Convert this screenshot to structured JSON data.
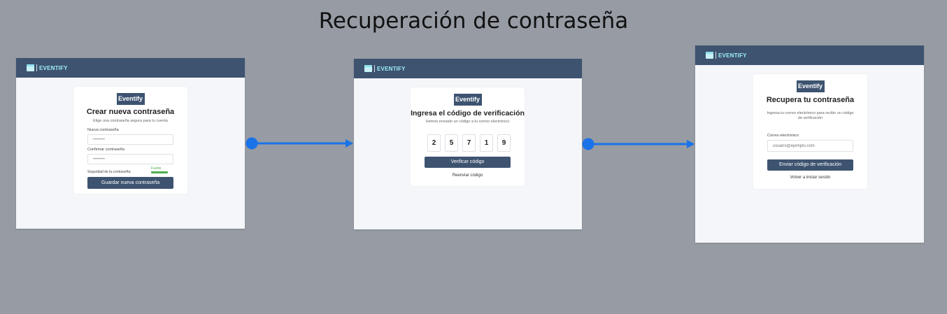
{
  "page_title": "Recuperación de contraseña",
  "colors": {
    "background": "#969ba4",
    "header": "#3d5370",
    "accent_arrow": "#1a73e8",
    "logo_text": "#9ef0f4",
    "strength_bar": "#4caf50"
  },
  "app_logo": {
    "text": "EVENTIFY",
    "icon": "calendar-icon"
  },
  "screen_create": {
    "brand": "Eventify",
    "title": "Crear nueva contraseña",
    "subtitle": "Elige una contraseña segura para tu cuenta",
    "new_label": "Nueva contraseña",
    "new_value": "••••••••",
    "confirm_label": "Confirmar contraseña",
    "confirm_value": "••••••••",
    "strength_label": "Seguridad de la contraseña:",
    "strength_value": "Fuerte",
    "strength_level": 1.0,
    "button": "Guardar nueva contraseña"
  },
  "screen_verify": {
    "brand": "Eventify",
    "title": "Ingresa el código de verificación",
    "subtitle": "Hemos enviado un código a tu correo electrónico",
    "digits": [
      "2",
      "5",
      "7",
      "1",
      "9"
    ],
    "button": "Verificar código",
    "resend": "Reenviar código"
  },
  "screen_recover": {
    "brand": "Eventify",
    "title": "Recupera tu contraseña",
    "subtitle": "Ingresa tu correo electrónico para recibir un código de verificación",
    "email_label": "Correo electrónico",
    "email_placeholder": "usuario@ejemplo.com",
    "button": "Enviar código de verificación",
    "back_link": "Volver a iniciar sesión"
  }
}
